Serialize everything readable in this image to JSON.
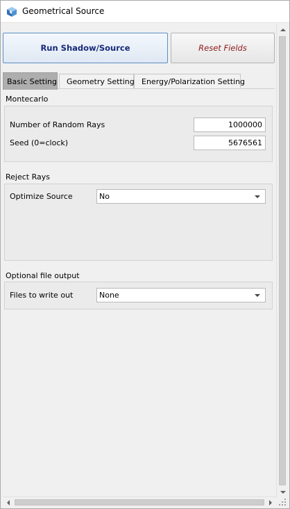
{
  "window": {
    "title": "Geometrical Source",
    "icon": "cube-icon"
  },
  "buttons": {
    "run_label": "Run Shadow/Source",
    "reset_label": "Reset Fields"
  },
  "tabs": [
    {
      "label": "Basic Setting",
      "active": true
    },
    {
      "label": "Geometry Setting",
      "active": false
    },
    {
      "label": "Energy/Polarization Setting",
      "active": false
    }
  ],
  "montecarlo": {
    "section_label": "Montecarlo",
    "rays_label": "Number of Random Rays",
    "rays_value": "1000000",
    "seed_label": "Seed (0=clock)",
    "seed_value": "5676561"
  },
  "reject": {
    "section_label": "Reject Rays",
    "optimize_label": "Optimize Source",
    "optimize_value": "No"
  },
  "output": {
    "section_label": "Optional file output",
    "files_label": "Files to write out",
    "files_value": "None"
  },
  "colors": {
    "run_text": "#162a7a",
    "reset_text": "#8e1818",
    "active_tab": "#aeaeae"
  }
}
